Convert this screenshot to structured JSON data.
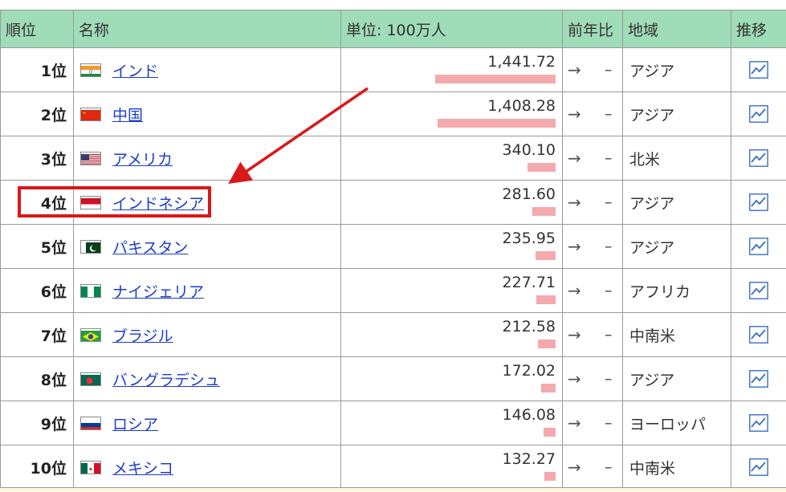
{
  "header": {
    "rank": "順位",
    "name": "名称",
    "unit": "単位: 100万人",
    "yoy": "前年比",
    "region": "地域",
    "trend": "推移"
  },
  "rows": [
    {
      "rank": "1位",
      "name": "インド",
      "value": "1,441.72",
      "arrow": "→",
      "change": "–",
      "region": "アジア",
      "flag": "india",
      "bar": 1.0
    },
    {
      "rank": "2位",
      "name": "中国",
      "value": "1,408.28",
      "arrow": "→",
      "change": "–",
      "region": "アジア",
      "flag": "china",
      "bar": 0.977
    },
    {
      "rank": "3位",
      "name": "アメリカ",
      "value": "340.10",
      "arrow": "→",
      "change": "–",
      "region": "北米",
      "flag": "usa",
      "bar": 0.236
    },
    {
      "rank": "4位",
      "name": "インドネシア",
      "value": "281.60",
      "arrow": "→",
      "change": "–",
      "region": "アジア",
      "flag": "indonesia",
      "bar": 0.195
    },
    {
      "rank": "5位",
      "name": "パキスタン",
      "value": "235.95",
      "arrow": "→",
      "change": "–",
      "region": "アジア",
      "flag": "pakistan",
      "bar": 0.164
    },
    {
      "rank": "6位",
      "name": "ナイジェリア",
      "value": "227.71",
      "arrow": "→",
      "change": "–",
      "region": "アフリカ",
      "flag": "nigeria",
      "bar": 0.158
    },
    {
      "rank": "7位",
      "name": "ブラジル",
      "value": "212.58",
      "arrow": "→",
      "change": "–",
      "region": "中南米",
      "flag": "brazil",
      "bar": 0.147
    },
    {
      "rank": "8位",
      "name": "バングラデシュ",
      "value": "172.02",
      "arrow": "→",
      "change": "–",
      "region": "アジア",
      "flag": "bangladesh",
      "bar": 0.119
    },
    {
      "rank": "9位",
      "name": "ロシア",
      "value": "146.08",
      "arrow": "→",
      "change": "–",
      "region": "ヨーロッパ",
      "flag": "russia",
      "bar": 0.101
    },
    {
      "rank": "10位",
      "name": "メキシコ",
      "value": "132.27",
      "arrow": "→",
      "change": "–",
      "region": "中南米",
      "flag": "mexico",
      "bar": 0.092
    }
  ],
  "colors": {
    "header_bg": "#9fdcb8",
    "bar": "#f4a9ad",
    "link": "#1a3ccc",
    "annotation": "#d81919"
  }
}
